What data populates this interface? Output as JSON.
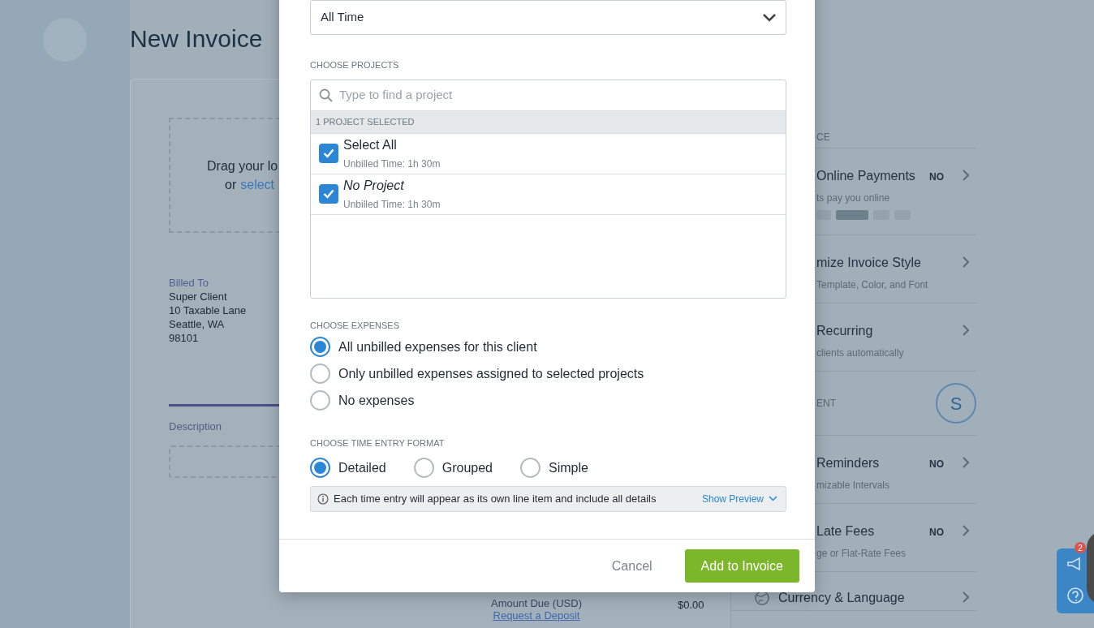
{
  "page": {
    "title": "New Invoice"
  },
  "logo_drop": {
    "line_1": "Drag your lo",
    "link_prefix": "or",
    "link": "select"
  },
  "billed_to": {
    "label": "Billed To",
    "lines": [
      "Super Client",
      "10 Taxable Lane",
      "Seattle, WA",
      "98101"
    ]
  },
  "line_items": {
    "column_1": "Description"
  },
  "totals": {
    "label": "Amount Due (USD)",
    "value": "$0.00",
    "link": "Request a Deposit"
  },
  "settings_panel": {
    "sections": [
      {
        "heading": "CE",
        "items": [
          {
            "kind": "payments",
            "title": "Online Payments",
            "subtitle": "ts pay you online",
            "value": "NO"
          },
          {
            "kind": "plain",
            "title": "mize Invoice Style",
            "subtitle": "Template, Color, and Font"
          },
          {
            "kind": "plain",
            "title": "Recurring",
            "subtitle": "clients automatically"
          }
        ]
      },
      {
        "heading": "ENT",
        "avatar": "S",
        "items": [
          {
            "kind": "plain",
            "title": "Reminders",
            "subtitle": "mizable Intervals",
            "value": "NO"
          },
          {
            "kind": "plain",
            "title": "Late Fees",
            "subtitle": "ge or Flat-Rate Fees",
            "value": "NO"
          },
          {
            "kind": "globe",
            "title": "Currency & Language"
          }
        ]
      }
    ]
  },
  "help_widget": {
    "badge": "2"
  },
  "modal": {
    "date_range": {
      "value": "All Time"
    },
    "projects": {
      "label": "CHOOSE PROJECTS",
      "search": {
        "placeholder": "Type to find a project"
      },
      "summary": "1 PROJECT SELECTED",
      "items": [
        {
          "name": "Select All",
          "detail": "Unbilled Time: 1h 30m",
          "checked": true,
          "italic": false
        },
        {
          "name": "No Project",
          "detail": "Unbilled Time: 1h 30m",
          "checked": true,
          "italic": true
        }
      ]
    },
    "expenses": {
      "label": "CHOOSE EXPENSES",
      "options": [
        {
          "label": "All unbilled expenses for this client",
          "selected": true
        },
        {
          "label": "Only unbilled expenses assigned to selected projects",
          "selected": false
        },
        {
          "label": "No expenses",
          "selected": false
        }
      ]
    },
    "time_format": {
      "label": "CHOOSE TIME ENTRY FORMAT",
      "options": [
        {
          "label": "Detailed",
          "selected": true
        },
        {
          "label": "Grouped",
          "selected": false
        },
        {
          "label": "Simple",
          "selected": false
        }
      ],
      "info": "Each time entry will appear as its own line item and include all details",
      "preview_link": "Show Preview"
    },
    "buttons": [
      {
        "label": "Cancel",
        "kind": "secondary"
      },
      {
        "label": "Add to Invoice",
        "kind": "primary"
      }
    ]
  }
}
